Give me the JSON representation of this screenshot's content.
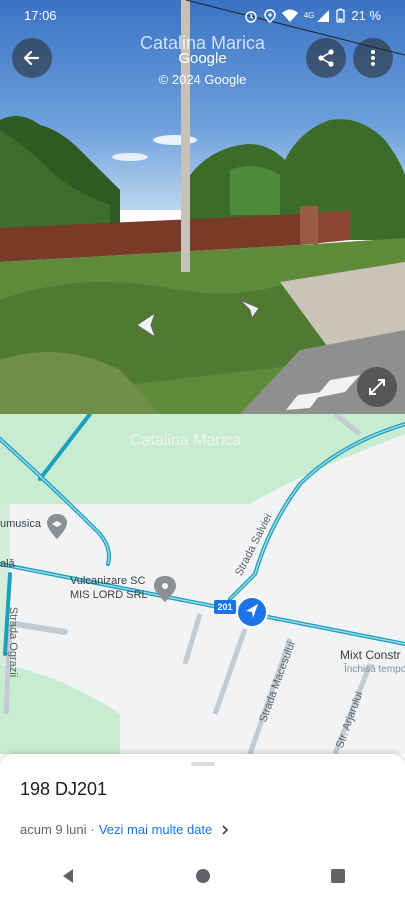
{
  "status_bar": {
    "time": "17:06",
    "network": "4G",
    "battery": "21 %",
    "icons": [
      "alarm-icon",
      "location-icon",
      "wifi-icon",
      "signal-icon",
      "battery-icon"
    ]
  },
  "street_view": {
    "place_title": "Catalina Marica",
    "watermark": "Google",
    "copyright": "© 2024 Google",
    "buttons": [
      "back-arrow-icon",
      "share-icon",
      "more-vert-icon",
      "expand-icon"
    ]
  },
  "map": {
    "labels": {
      "poi_school": "umusica",
      "poi_business": "Vulcanizare SC\nMIS LORD SRL",
      "road_number": "201",
      "street_salviei": "Strada Salviei",
      "street_ograzii": "Strada Ograzii",
      "street_macesului": "Strada Macesului",
      "street_arjarului": "Str. Arjarului",
      "road_left": "ală",
      "poi_right_title": "Mixt Constr",
      "poi_right_status": "Închisă tempo",
      "place_faded": "Catalina Marica"
    },
    "colors": {
      "road": "#1ba0c0",
      "green": "#c8ecd2",
      "bg": "#f1f3f4"
    }
  },
  "sheet": {
    "address": "198 DJ201",
    "date_text": "acum 9 luni",
    "separator": "·",
    "more_dates_link": "Vezi mai multe date"
  },
  "nav": {
    "buttons": [
      "back-triangle-icon",
      "home-circle-icon",
      "recents-square-icon"
    ]
  }
}
